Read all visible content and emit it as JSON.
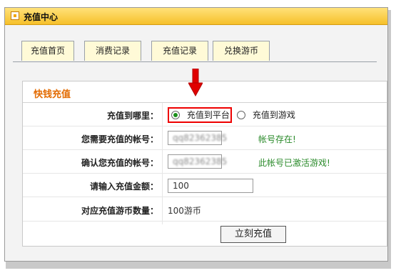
{
  "window": {
    "title": "充值中心"
  },
  "tabs": [
    {
      "label": "充值首页"
    },
    {
      "label": "消费记录"
    },
    {
      "label": "充值记录"
    },
    {
      "label": "兑换游币"
    }
  ],
  "form": {
    "section_title": "快钱充值",
    "recharge_to": {
      "label": "充值到哪里：",
      "options": [
        {
          "label": "充值到平台",
          "selected": true
        },
        {
          "label": "充值到游戏",
          "selected": false
        }
      ]
    },
    "account": {
      "label": "您需要充值的帐号：",
      "value": "qq82362385",
      "status": "帐号存在!"
    },
    "confirm_account": {
      "label": "确认您充值的帐号：",
      "value": "qq82362385",
      "status": "此帐号已激活游戏!"
    },
    "amount": {
      "label": "请输入充值金额：",
      "value": "100"
    },
    "coins": {
      "label": "对应充值游币数量：",
      "value": "100游币"
    },
    "submit_label": "立刻充值"
  },
  "colors": {
    "titlebar": "#f6c02a",
    "section_title": "#e36b00",
    "highlight": "#e00000",
    "status_ok": "#2a8a2a",
    "arrow": "#e00000"
  }
}
